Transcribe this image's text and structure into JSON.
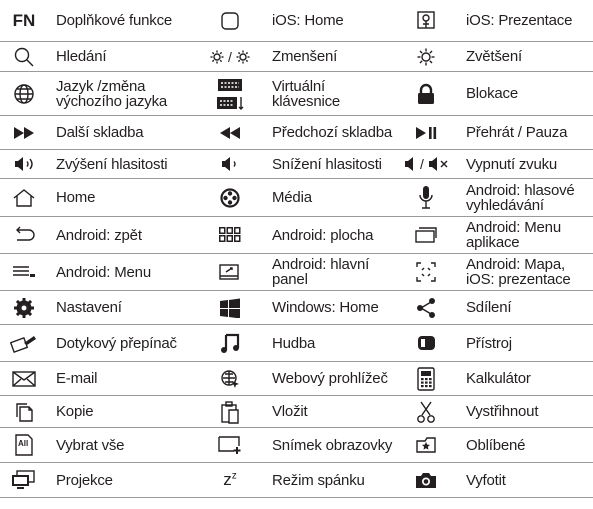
{
  "rows": [
    [
      {
        "icon": "fn-text-icon",
        "text": "FN",
        "label": "Doplňkové funkce"
      },
      {
        "icon": "rounded-square-icon",
        "label": "iOS: Home"
      },
      {
        "icon": "presentation-stand-icon",
        "label": "iOS: Prezentace"
      }
    ],
    [
      {
        "icon": "magnifier-icon",
        "label": "Hledání"
      },
      {
        "icon": "brightness-down-up-icon",
        "text": "/",
        "label": "Zmenšení"
      },
      {
        "icon": "brightness-up-icon",
        "label": "Zvětšení"
      }
    ],
    [
      {
        "icon": "globe-icon",
        "label": "Jazyk /změna výchozího jazyka"
      },
      {
        "icon": "keyboard-icons",
        "label": "Virtuální klávesnice"
      },
      {
        "icon": "lock-icon",
        "label": "Blokace"
      }
    ],
    [
      {
        "icon": "fast-forward-icon",
        "label": "Další skladba"
      },
      {
        "icon": "rewind-icon",
        "label": "Předchozí skladba"
      },
      {
        "icon": "play-pause-icon",
        "label": "Přehrát / Pauza"
      }
    ],
    [
      {
        "icon": "volume-up-icon",
        "label": "Zvýšení hlasitosti"
      },
      {
        "icon": "volume-down-icon",
        "label": "Snížení hlasitosti"
      },
      {
        "icon": "mute-icon",
        "text": "/",
        "label": "Vypnutí zvuku"
      }
    ],
    [
      {
        "icon": "home-icon",
        "label": "Home"
      },
      {
        "icon": "film-reel-icon",
        "label": "Média"
      },
      {
        "icon": "microphone-icon",
        "label": "Android: hlasové vyhledávání"
      }
    ],
    [
      {
        "icon": "back-arrow-icon",
        "label": "Android: zpět"
      },
      {
        "icon": "desktop-grid-icon",
        "label": "Android: plocha"
      },
      {
        "icon": "app-menu-icon",
        "label": "Android: Menu aplikace"
      }
    ],
    [
      {
        "icon": "menu-lines-icon",
        "label": "Android: Menu"
      },
      {
        "icon": "main-panel-icon",
        "label": "Android: hlavní panel"
      },
      {
        "icon": "screen-fit-icon",
        "label": "Android: Mapa, iOS: prezentace"
      }
    ],
    [
      {
        "icon": "gear-icon",
        "label": "Nastavení"
      },
      {
        "icon": "windows-logo-icon",
        "label": "Windows: Home"
      },
      {
        "icon": "share-icon",
        "label": "Sdílení"
      }
    ],
    [
      {
        "icon": "touchpad-switch-icon",
        "label": "Dotykový přepínač"
      },
      {
        "icon": "music-note-icon",
        "label": "Hudba"
      },
      {
        "icon": "device-icon",
        "label": "Přístroj"
      }
    ],
    [
      {
        "icon": "envelope-icon",
        "label": "E-mail"
      },
      {
        "icon": "web-browser-icon",
        "label": "Webový prohlížeč"
      },
      {
        "icon": "calculator-icon",
        "label": "Kalkulátor"
      }
    ],
    [
      {
        "icon": "copy-icon",
        "label": "Kopie"
      },
      {
        "icon": "paste-icon",
        "label": "Vložit"
      },
      {
        "icon": "scissors-icon",
        "label": "Vystřihnout"
      }
    ],
    [
      {
        "icon": "select-all-icon",
        "text": "All",
        "label": "Vybrat vše"
      },
      {
        "icon": "screenshot-icon",
        "label": "Snímek obrazovky"
      },
      {
        "icon": "favorite-star-icon",
        "label": "Oblíbené"
      }
    ],
    [
      {
        "icon": "projection-icon",
        "label": "Projekce"
      },
      {
        "icon": "sleep-icon",
        "text": "z",
        "text2": "z",
        "label": "Režim spánku"
      },
      {
        "icon": "camera-icon",
        "label": "Vyfotit"
      }
    ]
  ]
}
